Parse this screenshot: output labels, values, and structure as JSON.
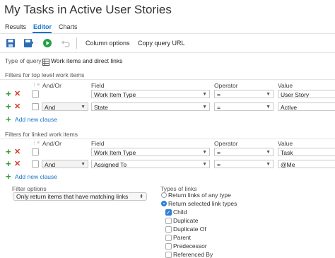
{
  "title": "My Tasks in Active User Stories",
  "tabs": [
    "Results",
    "Editor",
    "Charts"
  ],
  "toolbar": {
    "column_options": "Column options",
    "copy_query_url": "Copy query URL"
  },
  "query_type": {
    "label": "Type of query",
    "value": "Work items and direct links"
  },
  "top_filters": {
    "heading": "Filters for top level work items",
    "columns": {
      "andor": "And/Or",
      "field": "Field",
      "operator": "Operator",
      "value": "Value"
    },
    "rows": [
      {
        "andor": "",
        "field": "Work Item Type",
        "operator": "=",
        "value": "User Story"
      },
      {
        "andor": "And",
        "field": "State",
        "operator": "=",
        "value": "Active"
      }
    ],
    "add_clause": "Add new clause"
  },
  "linked_filters": {
    "heading": "Filters for linked work items",
    "columns": {
      "andor": "And/Or",
      "field": "Field",
      "operator": "Operator",
      "value": "Value"
    },
    "rows": [
      {
        "andor": "",
        "field": "Work Item Type",
        "operator": "=",
        "value": "Task"
      },
      {
        "andor": "And",
        "field": "Assigned To",
        "operator": "=",
        "value": "@Me"
      }
    ],
    "add_clause": "Add new clause"
  },
  "filter_options": {
    "label": "Filter options",
    "selected": "Only return items that have matching links"
  },
  "types_of_links": {
    "label": "Types of links",
    "radio_any": "Return links of any type",
    "radio_selected": "Return selected link types",
    "items": [
      {
        "label": "Child",
        "checked": true
      },
      {
        "label": "Duplicate",
        "checked": false
      },
      {
        "label": "Duplicate Of",
        "checked": false
      },
      {
        "label": "Parent",
        "checked": false
      },
      {
        "label": "Predecessor",
        "checked": false
      },
      {
        "label": "Referenced By",
        "checked": false
      }
    ]
  },
  "colors": {
    "accent": "#1a73c8",
    "add": "#2e9b2e",
    "delete": "#d03a2a"
  }
}
